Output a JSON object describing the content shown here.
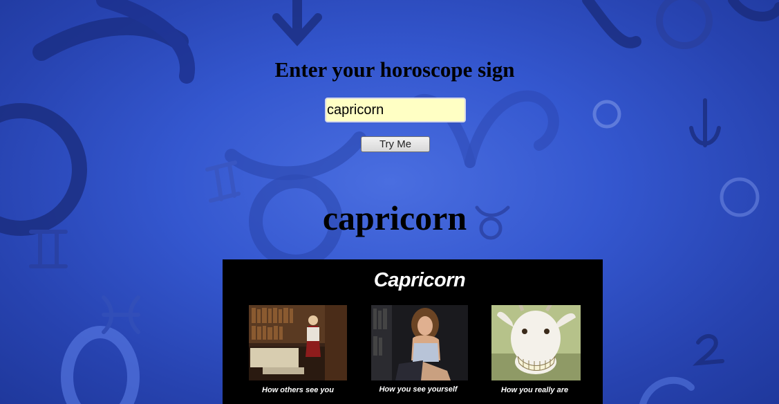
{
  "page": {
    "heading": "Enter your horoscope sign",
    "input_value": "capricorn",
    "button_label": "Try Me",
    "result_sign": "capricorn"
  },
  "meme": {
    "title": "Capricorn",
    "panels": [
      {
        "caption": "How others see you",
        "icon": "library-scene-image"
      },
      {
        "caption": "How you see yourself",
        "icon": "glamour-pose-image"
      },
      {
        "caption": "How you really are",
        "icon": "grinning-goat-image"
      }
    ]
  },
  "colors": {
    "background": "#3457cf",
    "input_background": "#ffffc4",
    "meme_background": "#000000"
  }
}
